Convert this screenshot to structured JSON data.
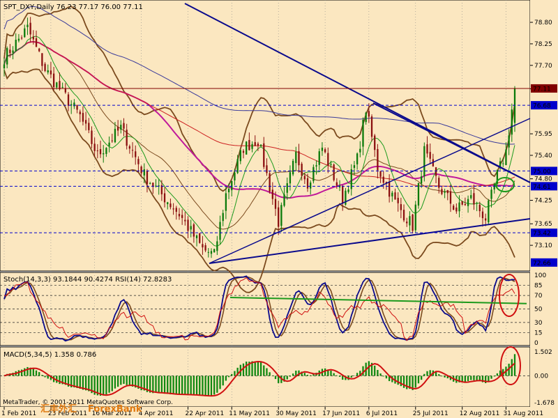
{
  "chart_data": [
    {
      "panel": "price",
      "type": "candlestick",
      "title": "SPT_DXY,Daily  76.23 77.17 76.00 77.11",
      "symbol": "SPT_DXY",
      "timeframe": "Daily",
      "ohlc_label": "76.23 77.17 76.00 77.11",
      "y_ticks": [
        "78.80",
        "78.25",
        "77.70",
        "77.10",
        "76.68",
        "75.95",
        "75.40",
        "74.80",
        "74.25",
        "73.65",
        "73.10",
        "72.66"
      ],
      "ylim": [
        72.55,
        79.05
      ],
      "price_levels": {
        "current": 77.11,
        "resistance": 76.68,
        "level_75": 75.0,
        "level_7461": 74.61,
        "support": 73.42,
        "low": 72.66
      },
      "highlight_labels": [
        "77.11",
        "76.68",
        "75.00",
        "74.61",
        "73.42",
        "72.66"
      ],
      "dates": [
        "1 Feb 2011",
        "23 Feb 2011",
        "16 Mar 2011",
        "4 Apr 2011",
        "22 Apr 2011",
        "11 May 2011",
        "30 May 2011",
        "17 Jun 2011",
        "6 Jul 2011",
        "25 Jul 2011",
        "12 Aug 2011",
        "31 Aug 2011"
      ],
      "anchors": [
        {
          "day": 0,
          "close": 77.9
        },
        {
          "day": 8,
          "close": 78.65
        },
        {
          "day": 14,
          "close": 77.6
        },
        {
          "day": 26,
          "close": 76.4
        },
        {
          "day": 32,
          "close": 75.4
        },
        {
          "day": 40,
          "close": 76.1
        },
        {
          "day": 48,
          "close": 74.9
        },
        {
          "day": 60,
          "close": 73.9
        },
        {
          "day": 68,
          "close": 73.0
        },
        {
          "day": 72,
          "close": 72.85
        },
        {
          "day": 76,
          "close": 74.4
        },
        {
          "day": 82,
          "close": 75.6
        },
        {
          "day": 87,
          "close": 75.8
        },
        {
          "day": 94,
          "close": 73.7
        },
        {
          "day": 100,
          "close": 75.4
        },
        {
          "day": 104,
          "close": 74.7
        },
        {
          "day": 109,
          "close": 75.6
        },
        {
          "day": 116,
          "close": 74.3
        },
        {
          "day": 121,
          "close": 75.3
        },
        {
          "day": 124,
          "close": 76.6
        },
        {
          "day": 128,
          "close": 75.1
        },
        {
          "day": 134,
          "close": 74.2
        },
        {
          "day": 140,
          "close": 73.6
        },
        {
          "day": 144,
          "close": 75.5
        },
        {
          "day": 149,
          "close": 74.6
        },
        {
          "day": 155,
          "close": 74.0
        },
        {
          "day": 160,
          "close": 74.3
        },
        {
          "day": 165,
          "close": 73.8
        },
        {
          "day": 169,
          "close": 74.9
        },
        {
          "day": 172,
          "close": 75.5
        },
        {
          "day": 175,
          "close": 77.11
        }
      ],
      "candles_total": 176
    },
    {
      "panel": "oscillators",
      "type": "line",
      "title": "Stoch(14,3,3) 93.1844 90.4274  RSI(14) 72.8283",
      "stoch_main": 93.1844,
      "stoch_signal": 90.4274,
      "rsi": 72.8283,
      "y_ticks": [
        "100",
        "85",
        "70",
        "50",
        "30",
        "15",
        "0"
      ],
      "ylim": [
        0,
        100
      ]
    },
    {
      "panel": "macd",
      "type": "bar",
      "title": "MACD(5,34,5) 1.358 0.786",
      "macd": 1.358,
      "signal": 0.786,
      "y_ticks": [
        "1.502",
        "0.00",
        "-1.678"
      ],
      "ylim": [
        -1.678,
        1.502
      ]
    }
  ],
  "footer": {
    "watermark_cn": "汇丰外汇",
    "watermark_site": "ForexBank",
    "copyright": "MetaTrader, © 2001-2011 MetaQuotes Software Corp."
  },
  "colors": {
    "background": "#FBE7C0",
    "frame": "#000000",
    "bull_candle": "#0A7A0A",
    "bear_candle": "#8B1010",
    "ma_magenta": "#C0189A",
    "bollinger": "#7B4A1E",
    "ma_red": "#CC2020",
    "trendline": "#0A0A8C",
    "ema_green": "#1C9A1C",
    "stoch_main": "#0A0A8C",
    "stoch_signal": "#7B4A1E",
    "rsi": "#D01010",
    "level_line": "#0000CC",
    "highlight_box": "#0000CC",
    "highlight_current": "#800000",
    "macd_hist": "#118811",
    "macd_signal": "#D01010",
    "circle": "#D01010",
    "circle_green": "#1C9A1C",
    "axis_text": "#000000"
  }
}
